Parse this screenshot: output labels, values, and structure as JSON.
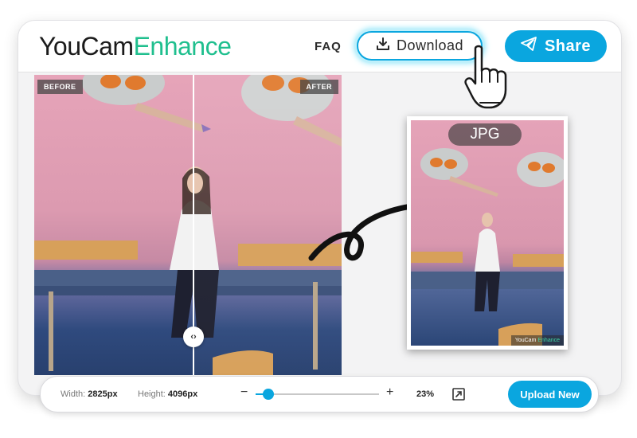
{
  "header": {
    "logo_part1": "YouCam",
    "logo_part2": "Enhance",
    "faq_label": "FAQ",
    "download_label": "Download",
    "share_label": "Share"
  },
  "preview": {
    "before_label": "BEFORE",
    "after_label": "AFTER",
    "compare_handle_glyph": "‹›"
  },
  "output": {
    "format_label": "JPG",
    "watermark_part1": "YouCam",
    "watermark_part2": "Enhance"
  },
  "footer": {
    "width_label": "Width:",
    "width_value": "2825px",
    "height_label": "Height:",
    "height_value": "4096px",
    "zoom_out": "−",
    "zoom_in": "+",
    "zoom_value": "23%",
    "zoom_level": 0.1,
    "upload_label": "Upload New"
  },
  "icons": {
    "download": "download-icon",
    "share": "paper-plane-icon",
    "expand": "expand-icon",
    "cursor": "hand-pointer-icon"
  },
  "colors": {
    "accent": "#0aa6df",
    "brand_green": "#1fbf8e"
  }
}
